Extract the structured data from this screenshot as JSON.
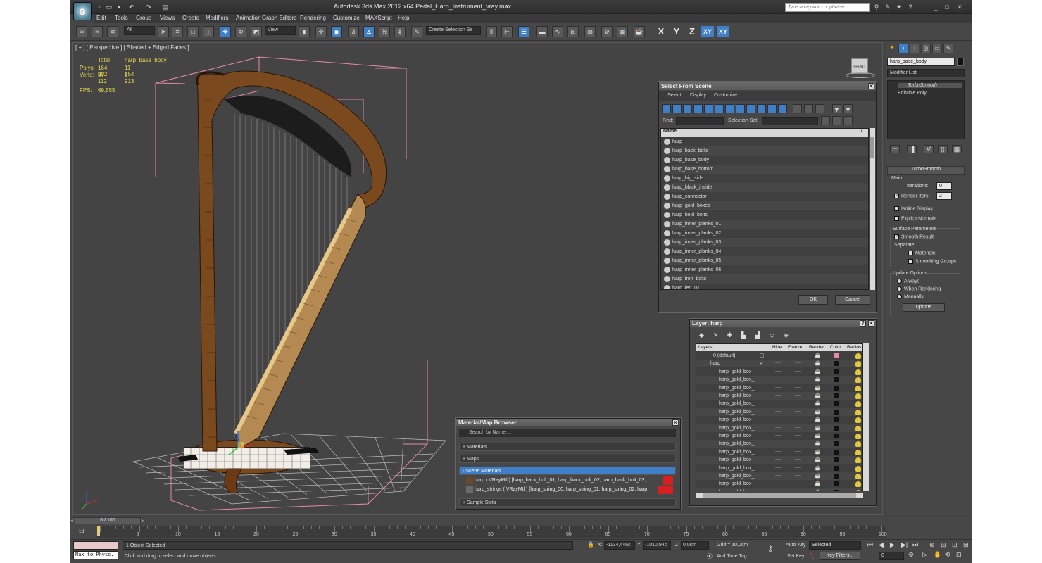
{
  "app": {
    "title": "Autodesk 3ds Max  2012 x64     Pedal_Harp_Instrument_vray.max",
    "logo": "G",
    "search_placeholder": "Type a keyword or phrase"
  },
  "menu": [
    "Edit",
    "Tools",
    "Group",
    "Views",
    "Create",
    "Modifiers",
    "Animation",
    "Graph Editors",
    "Rendering",
    "Customize",
    "MAXScript",
    "Help"
  ],
  "toolbar": {
    "filter_value": "All",
    "refcoord_value": "View",
    "named_selection_placeholder": "Create Selection Se",
    "snaps": [
      "3",
      "%"
    ],
    "axes": [
      "X",
      "Y",
      "Z",
      "XY",
      "XY"
    ]
  },
  "viewport": {
    "label": "[ + ] [ Perspective ] [ Shaded + Edged Faces ]",
    "stats": {
      "col_total": "Total",
      "col_object": "harp_base_body",
      "polys_label": "Polys:",
      "polys_total": "164 992",
      "polys_obj": "11 854",
      "verts_label": "Verts:",
      "verts_total": "87 112",
      "verts_obj": "5 913",
      "fps_label": "FPS:",
      "fps_value": "69,555"
    },
    "viewcube_label": "FRONT"
  },
  "command_panel": {
    "object_name": "harp_base_body",
    "modifier_list": "Modifier List",
    "stack": [
      "TurboSmooth",
      "Editable Poly"
    ],
    "rollout_title": "TurboSmooth",
    "main_label": "Main",
    "iterations_label": "Iterations:",
    "iterations_value": "0",
    "render_iters_label": "Render Iters:",
    "render_iters_value": "2",
    "isoline_label": "Isoline Display",
    "explicit_normals_label": "Explicit Normals",
    "surface_params_label": "Surface Parameters",
    "smooth_result_label": "Smooth Result",
    "separate_label": "Separate",
    "materials_label": "Materials",
    "smoothing_groups_label": "Smoothing Groups",
    "update_options_label": "Update Options",
    "always_label": "Always",
    "when_rendering_label": "When Rendering",
    "manually_label": "Manually",
    "update_button": "Update"
  },
  "select_from_scene": {
    "title": "Select From Scene",
    "menu": [
      "Select",
      "Display",
      "Customize"
    ],
    "find_label": "Find:",
    "selection_set_label": "Selection Set:",
    "column_name": "Name",
    "sort_indicator": "/",
    "items": [
      "harp",
      "harp_back_bolts",
      "harp_base_body",
      "harp_base_bottom",
      "harp_big_side",
      "harp_black_inside",
      "harp_connector",
      "harp_gold_boxes",
      "harp_hold_bolts",
      "harp_inner_planks_01",
      "harp_inner_planks_02",
      "harp_inner_planks_03",
      "harp_inner_planks_04",
      "harp_inner_planks_05",
      "harp_inner_planks_06",
      "harp_iron_bolts",
      "harp_leg_01"
    ],
    "ok": "OK",
    "cancel": "Cancel"
  },
  "layer_dialog": {
    "title": "Layer: harp",
    "help": "?",
    "headers": [
      "Layers",
      "Hide",
      "Freeze",
      "Render",
      "Color",
      "Radios"
    ],
    "dash": "----",
    "check": "✓",
    "rows": [
      {
        "name": "0 (default)",
        "indent": 1
      },
      {
        "name": "harp",
        "indent": 0
      },
      {
        "name": "harp_gold_box_",
        "indent": 2
      },
      {
        "name": "harp_gold_box_",
        "indent": 2
      },
      {
        "name": "harp_gold_box_",
        "indent": 2
      },
      {
        "name": "harp_gold_box_",
        "indent": 2
      },
      {
        "name": "harp_gold_box_",
        "indent": 2
      },
      {
        "name": "harp_gold_box_",
        "indent": 2
      },
      {
        "name": "harp_gold_box_",
        "indent": 2
      },
      {
        "name": "harp_gold_box_",
        "indent": 2
      },
      {
        "name": "harp_gold_box_",
        "indent": 2
      },
      {
        "name": "harp_gold_box_",
        "indent": 2
      },
      {
        "name": "harp_gold_box_",
        "indent": 2
      },
      {
        "name": "harp_gold_box_",
        "indent": 2
      },
      {
        "name": "harp_gold_box_",
        "indent": 2
      },
      {
        "name": "harp_gold_box_",
        "indent": 2
      },
      {
        "name": "harp_gold_box_",
        "indent": 2
      },
      {
        "name": "harp_gold_box_",
        "indent": 2
      },
      {
        "name": "harp_gold_box_",
        "indent": 2
      }
    ]
  },
  "material_browser": {
    "title": "Material/Map Browser",
    "search_placeholder": "Search by Name ...",
    "sections": [
      "+ Materials",
      "+ Maps",
      "- Scene Materials",
      "+ Sample Slots"
    ],
    "scene_materials": [
      "harp  ( VRayMtl ) [harp_back_bolt_01, harp_back_bolt_02, harp_back_bolt_03,",
      "harp_strings  ( VRayMtl ) [harp_string_00, harp_string_01, harp_string_02, harp"
    ]
  },
  "timeline": {
    "frame_display": "0 / 100",
    "prev": "<",
    "next": ">",
    "ticks": [
      "0",
      "5",
      "10",
      "15",
      "20",
      "25",
      "30",
      "35",
      "40",
      "45",
      "50",
      "55",
      "60",
      "65",
      "70",
      "75",
      "80",
      "85",
      "90",
      "95",
      "100"
    ]
  },
  "status": {
    "script_label": "Max to Physc.",
    "selection": "1 Object Selected",
    "prompt": "Click and drag to select and move objects",
    "x_label": "X:",
    "x_value": "-1134,446c",
    "y_label": "Y:",
    "y_value": "-1010,94c",
    "z_label": "Z:",
    "z_value": "0,0cm",
    "grid": "Grid = 10,0cm",
    "add_time_tag": "Add Time Tag",
    "auto_key": "Auto Key",
    "set_key": "Set Key",
    "selected_value": "Selected",
    "key_filters": "Key Filters...",
    "frame_value": "0"
  },
  "colors": {
    "accent": "#3e7fc8",
    "stats": "#e8d84a",
    "bbox": "#e58aa8",
    "wood": "#7a4a1e"
  }
}
